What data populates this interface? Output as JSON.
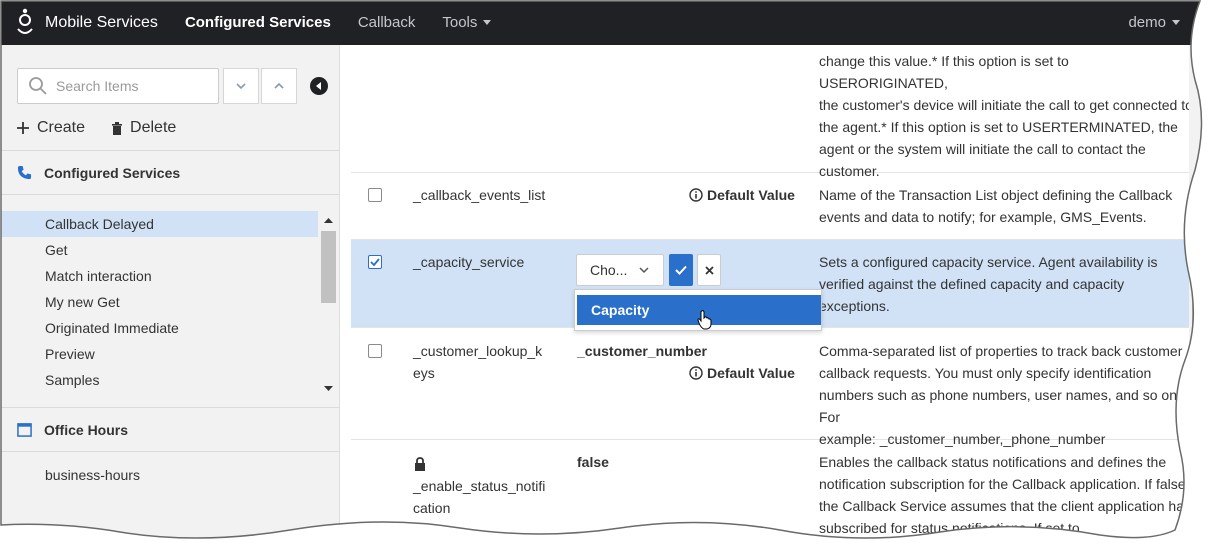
{
  "nav": {
    "brand": "Mobile Services",
    "items": [
      {
        "label": "Configured Services",
        "active": true
      },
      {
        "label": "Callback",
        "active": false
      },
      {
        "label": "Tools",
        "active": false
      }
    ],
    "user": "demo"
  },
  "sidebar": {
    "search_placeholder": "Search Items",
    "create_label": "Create",
    "delete_label": "Delete",
    "section_configured": "Configured Services",
    "items": [
      {
        "label": "Callback Delayed",
        "selected": true
      },
      {
        "label": "Get",
        "selected": false
      },
      {
        "label": "Match interaction",
        "selected": false
      },
      {
        "label": "My new Get",
        "selected": false
      },
      {
        "label": "Originated Immediate",
        "selected": false
      },
      {
        "label": "Preview",
        "selected": false
      },
      {
        "label": "Samples",
        "selected": false
      }
    ],
    "section_office": "Office Hours",
    "office_item": "business-hours"
  },
  "table": {
    "row0": {
      "desc_lines": [
        "change this value.* If this option is set to USERORIGINATED,",
        "the customer's device will initiate the call to get connected to",
        "the agent.* If this option is set to USERTERMINATED, the",
        "agent or the system will initiate the call to contact the",
        "customer."
      ]
    },
    "row1": {
      "name": "_callback_events_list",
      "default_label": "Default Value",
      "desc_lines": [
        "Name of the Transaction List object defining the Callback",
        "events and data to notify; for example, GMS_Events."
      ]
    },
    "row2": {
      "name": "_capacity_service",
      "select_value": "Cho...",
      "desc_lines": [
        "Sets a configured capacity service. Agent availability is",
        "verified against the defined capacity and capacity",
        "exceptions."
      ]
    },
    "dropdown_option": "Capacity",
    "row3": {
      "name_lines": [
        "_customer_lookup_k",
        "eys"
      ],
      "value": "_customer_number",
      "default_label": "Default Value",
      "desc_lines": [
        "Comma-separated list of properties to track back customer",
        "callback requests. You must only specify identification",
        "numbers such as phone numbers, user names, and so on. For",
        "example: _customer_number,_phone_number"
      ]
    },
    "row4": {
      "name_lines": [
        "_enable_status_notifi",
        "cation"
      ],
      "value": "false",
      "desc_lines": [
        "Enables the callback status notifications and defines the",
        "notification subscription for the Callback application. If false",
        "the Callback Service assumes that the client application has",
        "subscribed for status notifications. If set to"
      ]
    }
  },
  "colors": {
    "accent": "#2a6fc9",
    "topbar": "#202125",
    "selected_row": "#d1e2f6"
  }
}
